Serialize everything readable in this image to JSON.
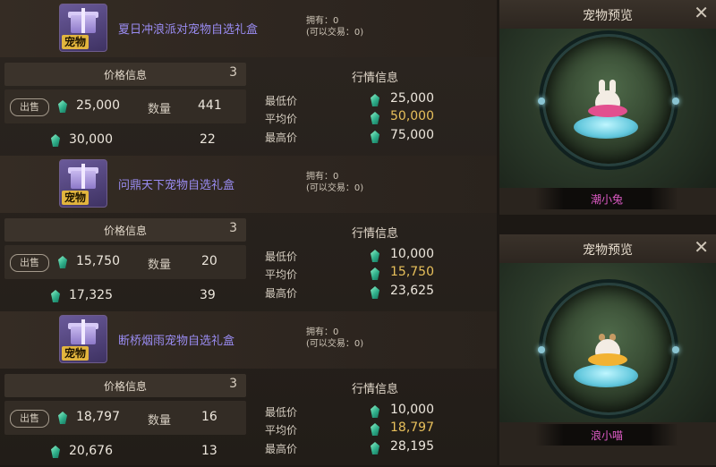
{
  "items": [
    {
      "name": "夏日冲浪派对宠物自选礼盒",
      "tag": "宠物",
      "owned": "拥有：0",
      "tradable": "(可以交易：0)",
      "price_panel": {
        "title": "价格信息",
        "count": "3",
        "sell_label": "出售",
        "row1_price": "25,000",
        "qty_label": "数量",
        "row1_qty": "441",
        "row2_price": "30,000",
        "row2_qty": "22"
      },
      "market_panel": {
        "title": "行情信息",
        "min_label": "最低价",
        "min": "25,000",
        "avg_label": "平均价",
        "avg": "50,000",
        "max_label": "最高价",
        "max": "75,000"
      }
    },
    {
      "name": "问鼎天下宠物自选礼盒",
      "tag": "宠物",
      "owned": "拥有：0",
      "tradable": "(可以交易：0)",
      "price_panel": {
        "title": "价格信息",
        "count": "3",
        "sell_label": "出售",
        "row1_price": "15,750",
        "qty_label": "数量",
        "row1_qty": "20",
        "row2_price": "17,325",
        "row2_qty": "39"
      },
      "market_panel": {
        "title": "行情信息",
        "min_label": "最低价",
        "min": "10,000",
        "avg_label": "平均价",
        "avg": "15,750",
        "max_label": "最高价",
        "max": "23,625"
      }
    },
    {
      "name": "断桥烟雨宠物自选礼盒",
      "tag": "宠物",
      "owned": "拥有：0",
      "tradable": "(可以交易：0)",
      "price_panel": {
        "title": "价格信息",
        "count": "3",
        "sell_label": "出售",
        "row1_price": "18,797",
        "qty_label": "数量",
        "row1_qty": "16",
        "row2_price": "20,676",
        "row2_qty": "13"
      },
      "market_panel": {
        "title": "行情信息",
        "min_label": "最低价",
        "min": "10,000",
        "avg_label": "平均价",
        "avg": "18,797",
        "max_label": "最高价",
        "max": "28,195"
      }
    }
  ],
  "previews": [
    {
      "title": "宠物预览",
      "close": "✕",
      "pet_name": "潮小兔",
      "float_color": "#e24f8f"
    },
    {
      "title": "宠物预览",
      "close": "✕",
      "pet_name": "浪小喵",
      "float_color": "#f2b233"
    }
  ],
  "colors": {
    "item_name": "#9a8cf2",
    "avg_price": "#e8c05b",
    "pet_name": "#e05cc8",
    "gem": "#2fae8a"
  },
  "icons": {
    "currency": "gem-icon",
    "item": "gift-box-icon",
    "close": "close-icon"
  }
}
